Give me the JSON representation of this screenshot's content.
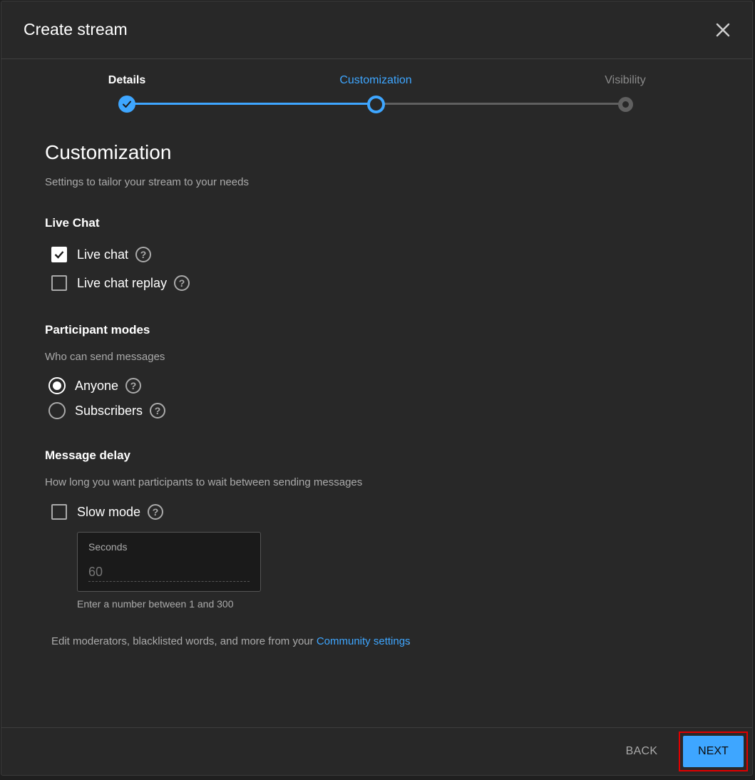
{
  "dialog": {
    "title": "Create stream"
  },
  "stepper": {
    "steps": [
      {
        "label": "Details",
        "state": "completed"
      },
      {
        "label": "Customization",
        "state": "current"
      },
      {
        "label": "Visibility",
        "state": "upcoming"
      }
    ]
  },
  "customization": {
    "heading": "Customization",
    "subtitle": "Settings to tailor your stream to your needs",
    "live_chat": {
      "heading": "Live Chat",
      "options": [
        {
          "label": "Live chat",
          "checked": true
        },
        {
          "label": "Live chat replay",
          "checked": false
        }
      ]
    },
    "participant_modes": {
      "heading": "Participant modes",
      "subtitle": "Who can send messages",
      "options": [
        {
          "label": "Anyone",
          "selected": true
        },
        {
          "label": "Subscribers",
          "selected": false
        }
      ]
    },
    "message_delay": {
      "heading": "Message delay",
      "subtitle": "How long you want participants to wait between sending messages",
      "slow_mode_label": "Slow mode",
      "slow_mode_checked": false,
      "seconds_label": "Seconds",
      "seconds_placeholder": "60",
      "hint": "Enter a number between 1 and 300"
    },
    "community_text": "Edit moderators, blacklisted words, and more from your",
    "community_link": "Community settings",
    "community_suffix": "."
  },
  "footer": {
    "back_label": "BACK",
    "next_label": "NEXT"
  },
  "colors": {
    "accent": "#3ea6ff",
    "background": "#282828",
    "highlight": "#e00000"
  }
}
